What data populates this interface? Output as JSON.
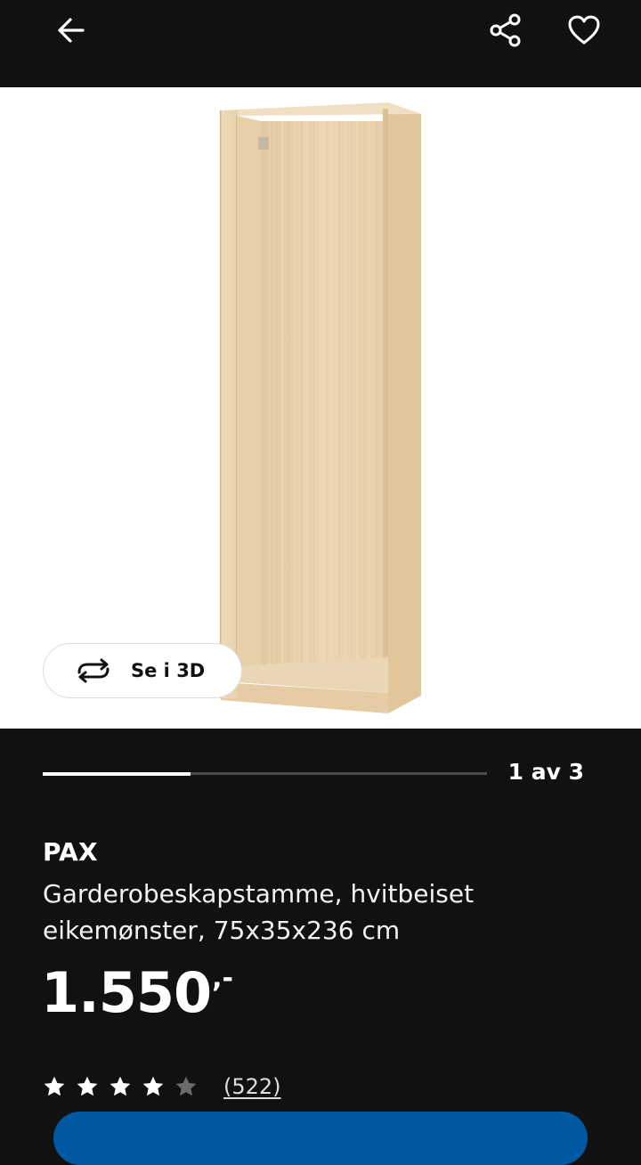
{
  "topbar": {
    "back_icon": "arrow-left-icon",
    "share_icon": "share-icon",
    "favourite_icon": "heart-icon"
  },
  "gallery": {
    "view3d_label": "Se i 3D",
    "view3d_icon": "rotate-3d-icon",
    "pager": "1 av 3",
    "progress": 0.333
  },
  "product": {
    "name": "PAX",
    "description": "Garderobeskapstamme, hvitbeiset eikemønster, 75x35x236 cm",
    "price_main": "1.550",
    "price_suffix": ",-",
    "rating": 4,
    "rating_max": 5,
    "review_count": "(522)"
  },
  "colors": {
    "background": "#111111",
    "accent_button": "#0058a3",
    "wood": "#ead5b2"
  }
}
